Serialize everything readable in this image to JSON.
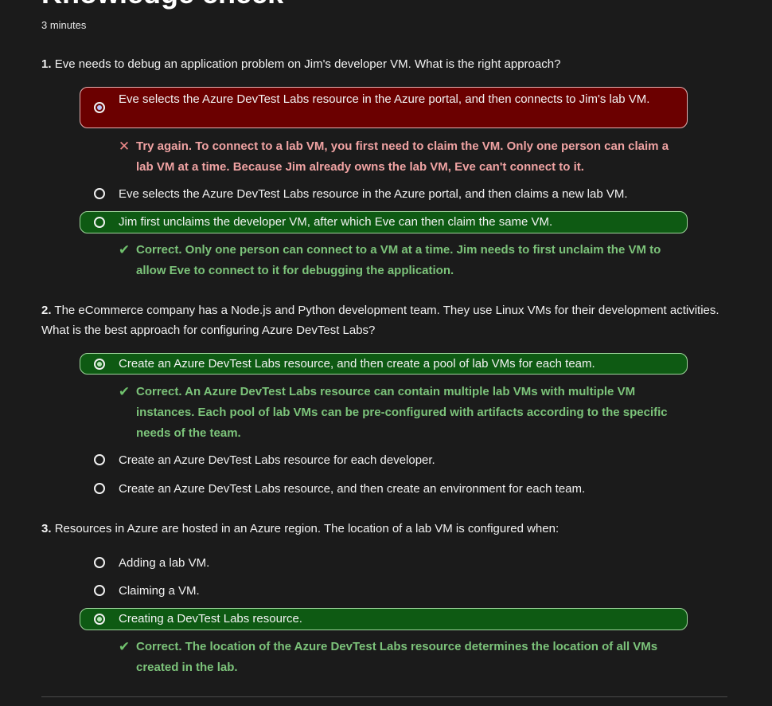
{
  "title": "Knowledge check",
  "duration": "3 minutes",
  "questions": [
    {
      "number": "1.",
      "text": "Eve needs to debug an application problem on Jim's developer VM. What is the right approach?",
      "choices": [
        {
          "label": "Eve selects the Azure DevTest Labs resource in the Azure portal, and then connects to Jim's lab VM.",
          "selected": true,
          "state": "incorrect",
          "feedback": "Try again. To connect to a lab VM, you first need to claim the VM. Only one person can claim a lab VM at a time. Because Jim already owns the lab VM, Eve can't connect to it."
        },
        {
          "label": "Eve selects the Azure DevTest Labs resource in the Azure portal, and then claims a new lab VM.",
          "selected": false,
          "state": "none"
        },
        {
          "label": "Jim first unclaims the developer VM, after which Eve can then claim the same VM.",
          "selected": false,
          "state": "correct",
          "feedback": "Correct. Only one person can connect to a VM at a time. Jim needs to first unclaim the VM to allow Eve to connect to it for debugging the application."
        }
      ]
    },
    {
      "number": "2.",
      "text": "The eCommerce company has a Node.js and Python development team. They use Linux VMs for their development activities. What is the best approach for configuring Azure DevTest Labs?",
      "choices": [
        {
          "label": "Create an Azure DevTest Labs resource, and then create a pool of lab VMs for each team.",
          "selected": true,
          "state": "correct",
          "feedback": "Correct. An Azure DevTest Labs resource can contain multiple lab VMs with multiple VM instances. Each pool of lab VMs can be pre-configured with artifacts according to the specific needs of the team."
        },
        {
          "label": "Create an Azure DevTest Labs resource for each developer.",
          "selected": false,
          "state": "none"
        },
        {
          "label": "Create an Azure DevTest Labs resource, and then create an environment for each team.",
          "selected": false,
          "state": "none"
        }
      ]
    },
    {
      "number": "3.",
      "text": "Resources in Azure are hosted in an Azure region. The location of a lab VM is configured when:",
      "choices": [
        {
          "label": "Adding a lab VM.",
          "selected": false,
          "state": "none"
        },
        {
          "label": "Claiming a VM.",
          "selected": false,
          "state": "none"
        },
        {
          "label": "Creating a DevTest Labs resource.",
          "selected": true,
          "state": "correct",
          "feedback": "Correct. The location of the Azure DevTest Labs resource determines the location of all VMs created in the lab."
        }
      ]
    }
  ],
  "icons": {
    "incorrect": "close-icon",
    "correct": "checkmark-icon"
  },
  "colors": {
    "background": "#1b1b1b",
    "incorrect_fill": "#6b0000",
    "correct_fill": "#0e5a13",
    "incorrect_text": "#f0a3a3",
    "correct_text": "#7cc37a"
  }
}
